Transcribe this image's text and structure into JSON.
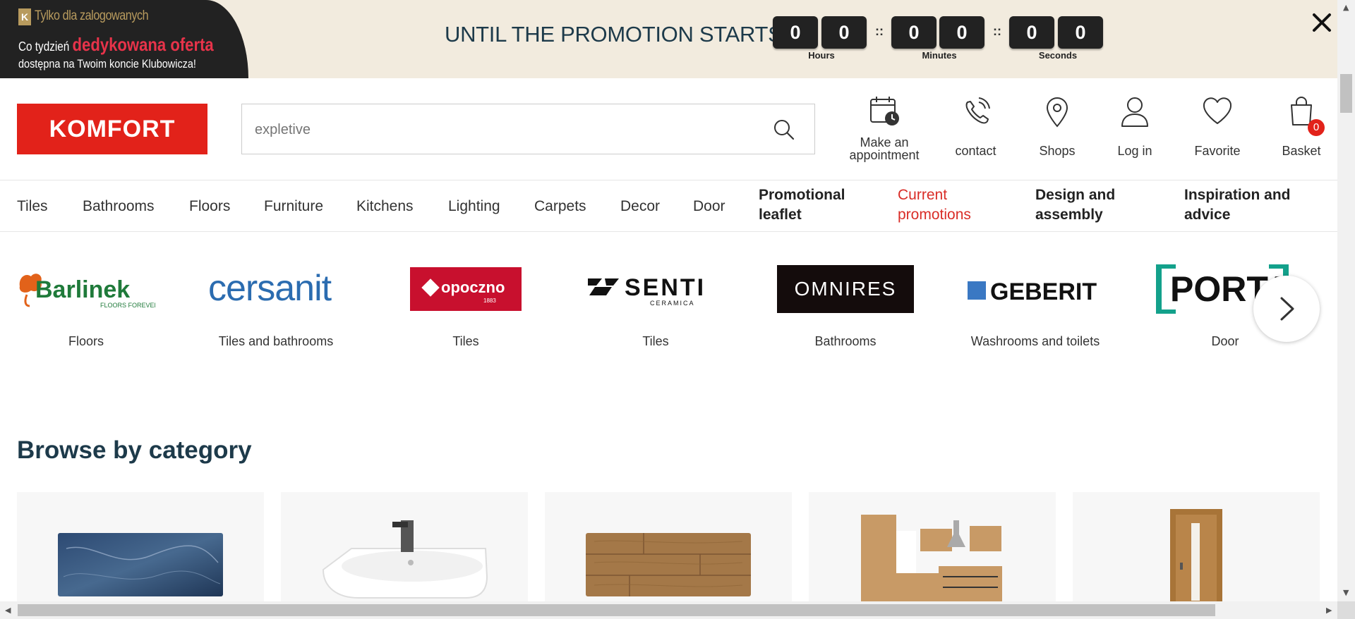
{
  "promo": {
    "banner": {
      "k_letter": "K",
      "line1": "Tylko dla zalogowanych",
      "line2_plain": "Co tydzień ",
      "line2_highlight": "dedykowana oferta",
      "line3": "dostępna na Twoim koncie Klubowicza!"
    },
    "title": "UNTIL THE PROMOTION STARTS:",
    "digits": [
      "0",
      "0",
      "0",
      "0",
      "0",
      "0"
    ],
    "separator": "::",
    "units": [
      "Hours",
      "Minutes",
      "Seconds"
    ]
  },
  "header": {
    "logo": "KOMFORT",
    "search_placeholder": "expletive",
    "actions": {
      "appointment": "Make an appointment",
      "contact": "contact",
      "shops": "Shops",
      "login": "Log in",
      "favorite": "Favorite",
      "basket": "Basket",
      "basket_count": "0"
    }
  },
  "nav": {
    "items": [
      "Tiles",
      "Bathrooms",
      "Floors",
      "Furniture",
      "Kitchens",
      "Lighting",
      "Carpets",
      "Decor",
      "Door"
    ],
    "promotional_leaflet": "Promotional leaflet",
    "current_promotions": "Current promotions",
    "design_assembly": "Design and assembly",
    "inspiration_advice": "Inspiration and advice"
  },
  "brands": [
    {
      "name": "Barlinek",
      "tagline": "FLOORS FOREVER",
      "category": "Floors"
    },
    {
      "name": "cersanit",
      "category": "Tiles and bathrooms"
    },
    {
      "name": "opoczno",
      "year": "1883",
      "category": "Tiles"
    },
    {
      "name": "SENTI",
      "sub": "CERAMICA",
      "category": "Tiles"
    },
    {
      "name": "OMNIRES",
      "category": "Bathrooms"
    },
    {
      "name": "GEBERIT",
      "category": "Washrooms and toilets"
    },
    {
      "name": "PORTA",
      "category": "Door"
    }
  ],
  "browse": {
    "title": "Browse by category"
  },
  "colors": {
    "brand_red": "#e2221a",
    "promo_bg": "#f2ebde",
    "heading": "#1d3a4a",
    "promo_link": "#d92d27"
  }
}
